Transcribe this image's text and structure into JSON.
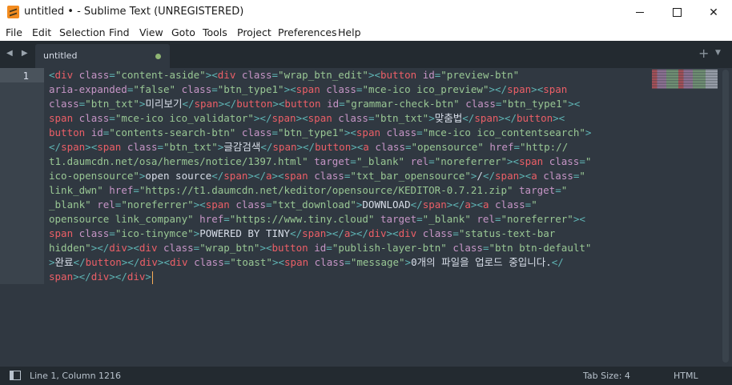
{
  "window": {
    "title": "untitled • - Sublime Text (UNREGISTERED)",
    "minimize_label": "—",
    "close_label": "✕"
  },
  "menu": {
    "items": [
      "File",
      "Edit",
      "Selection",
      "Find",
      "View",
      "Goto",
      "Tools",
      "Project",
      "Preferences",
      "Help"
    ]
  },
  "tabs": {
    "items": [
      {
        "label": "untitled",
        "modified": true
      }
    ],
    "nav_arrows": "◀ ▶",
    "new_tab": "+",
    "tab_menu": "▼"
  },
  "editor": {
    "line_numbers": [
      "1"
    ],
    "content": "<div class=\"content-aside\"><div class=\"wrap_btn_edit\"><button id=\"preview-btn\" aria-expanded=\"false\" class=\"btn_type1\"><span class=\"mce-ico ico_preview\"></span><span class=\"btn_txt\">미리보기</span></button><button id=\"grammar-check-btn\" class=\"btn_type1\"><span class=\"mce-ico ico_validator\"></span><span class=\"btn_txt\">맞춤법</span></button><button id=\"contents-search-btn\" class=\"btn_type1\"><span class=\"mce-ico ico_contentsearch\"></span><span class=\"btn_txt\">글감검색</span></button><a class=\"opensource\" href=\"http://t1.daumcdn.net/osa/hermes/notice/1397.html\" target=\"_blank\" rel=\"noreferrer\"><span class=\"ico-opensource\">open source</span></a><span class=\"txt_bar_opensource\">/</span><a class=\"link_dwn\" href=\"https://t1.daumcdn.net/keditor/opensource/KEDITOR-0.7.21.zip\" target=\"_blank\" rel=\"noreferrer\"><span class=\"txt_download\">DOWNLOAD</span></a><a class=\"opensource link_company\" href=\"https://www.tiny.cloud\" target=\"_blank\" rel=\"noreferrer\"><span class=\"ico-tinymce\">POWERED BY TINY</span></a></div><div class=\"status-text-bar hidden\"></div><div class=\"wrap_btn\"><button id=\"publish-layer-btn\" class=\"btn btn-default\">완료</button></div><div class=\"toast\"><span class=\"message\">0개의 파일을 업로드 중입니다.</span></div></div>"
  },
  "status": {
    "position": "Line 1, Column 1216",
    "tab_size": "Tab Size: 4",
    "syntax": "HTML"
  },
  "colors": {
    "editor_bg": "#303841",
    "tag": "#ec5f67",
    "attribute": "#c695c6",
    "string": "#99c794",
    "punctuation": "#5fb4b4",
    "text": "#d8dee9",
    "cursor": "#f9ae58",
    "modified_dot": "#8fb573"
  },
  "icons": {
    "app": "sublime-text-logo-icon",
    "panel": "toggle-side-panel-icon"
  }
}
